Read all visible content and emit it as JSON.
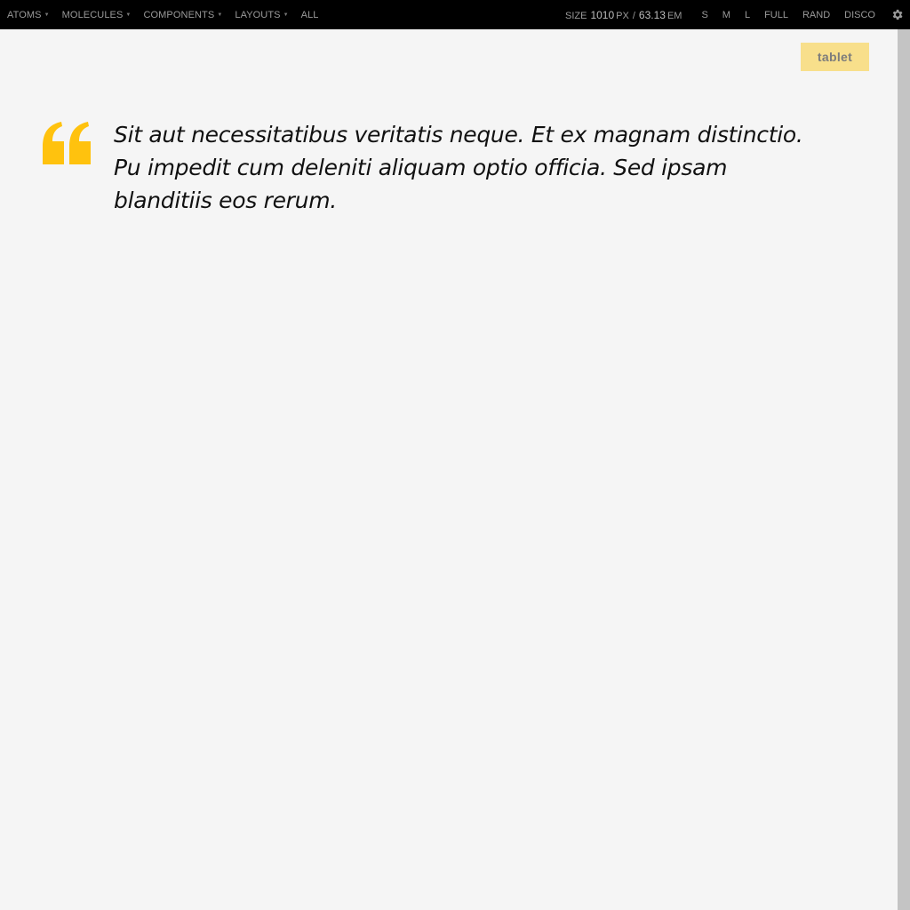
{
  "nav": {
    "items": [
      {
        "label": "ATOMS",
        "has_caret": true
      },
      {
        "label": "MOLECULES",
        "has_caret": true
      },
      {
        "label": "COMPONENTS",
        "has_caret": true
      },
      {
        "label": "LAYOUTS",
        "has_caret": true
      },
      {
        "label": "ALL",
        "has_caret": false
      }
    ]
  },
  "size": {
    "label": "SIZE",
    "px_value": "1010",
    "px_unit": "PX",
    "separator": "/",
    "em_value": "63.13",
    "em_unit": "EM"
  },
  "controls": {
    "s": "S",
    "m": "M",
    "l": "L",
    "full": "FULL",
    "rand": "RAND",
    "disco": "DISCO"
  },
  "icons": {
    "settings": "gear-icon",
    "quote": "quote-icon"
  },
  "viewport": {
    "badge": "tablet",
    "quote": "Sit aut necessitatibus veritatis neque. Et ex magnam distinctio. Pu impedit cum deleniti aliquam optio officia. Sed ipsam blanditiis eos rerum."
  },
  "colors": {
    "topbar_bg": "#000000",
    "viewport_bg": "#f5f5f5",
    "badge_bg": "#f8df8b",
    "quote_mark": "#ffc20e",
    "resize_handle": "#c4c4c4"
  }
}
